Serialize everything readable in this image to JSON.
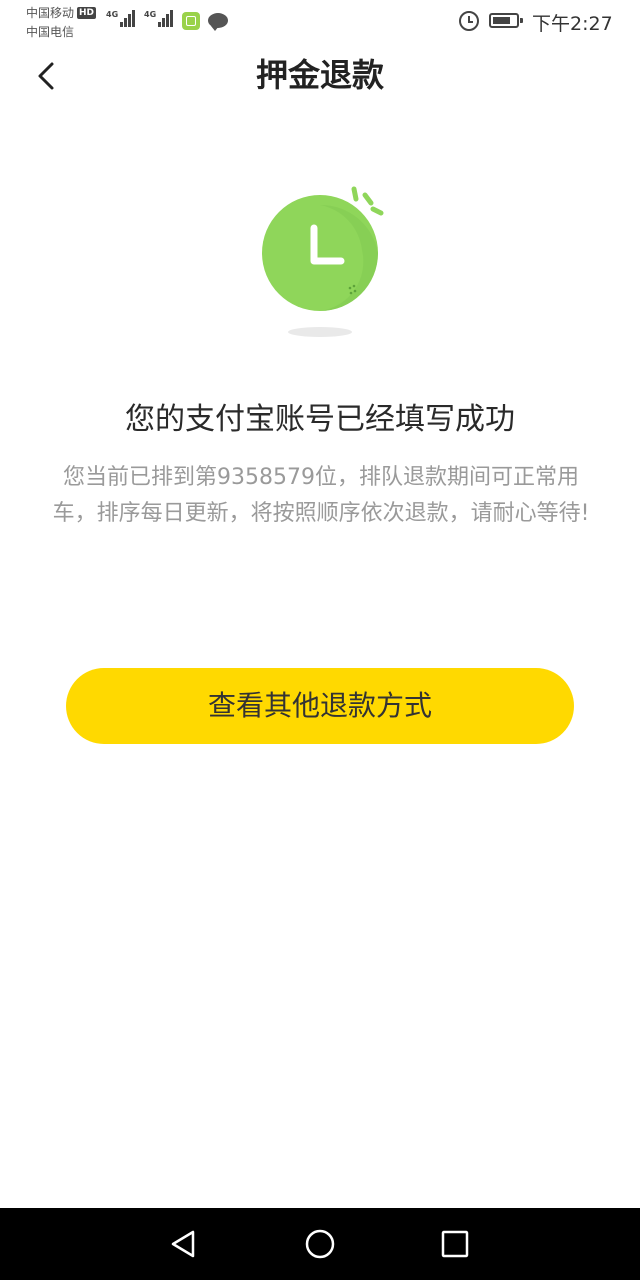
{
  "status_bar": {
    "carrier_1": "中国移动",
    "carrier_2": "中国电信",
    "hd_label": "HD",
    "network_1": "4G",
    "network_2": "4G",
    "time": "下午2:27",
    "icons": [
      "signal-icon",
      "wechat-icon",
      "chat-icon",
      "alarm-icon",
      "battery-icon"
    ]
  },
  "header": {
    "title": "押金退款",
    "back_icon": "back-arrow-icon"
  },
  "main": {
    "illustration": "clock-icon",
    "success_title": "您的支付宝账号已经填写成功",
    "queue_description": "您当前已排到第9358579位，排队退款期间可正常用车，排序每日更新，将按照顺序依次退款，请耐心等待!",
    "other_refund_button": "查看其他退款方式"
  },
  "nav_bar": {
    "icons": [
      "nav-back-icon",
      "nav-home-icon",
      "nav-recent-icon"
    ]
  },
  "colors": {
    "accent_yellow": "#ffd900",
    "clock_green": "#8fd65a",
    "title_text": "#222222",
    "desc_text": "#9a9a9a"
  }
}
